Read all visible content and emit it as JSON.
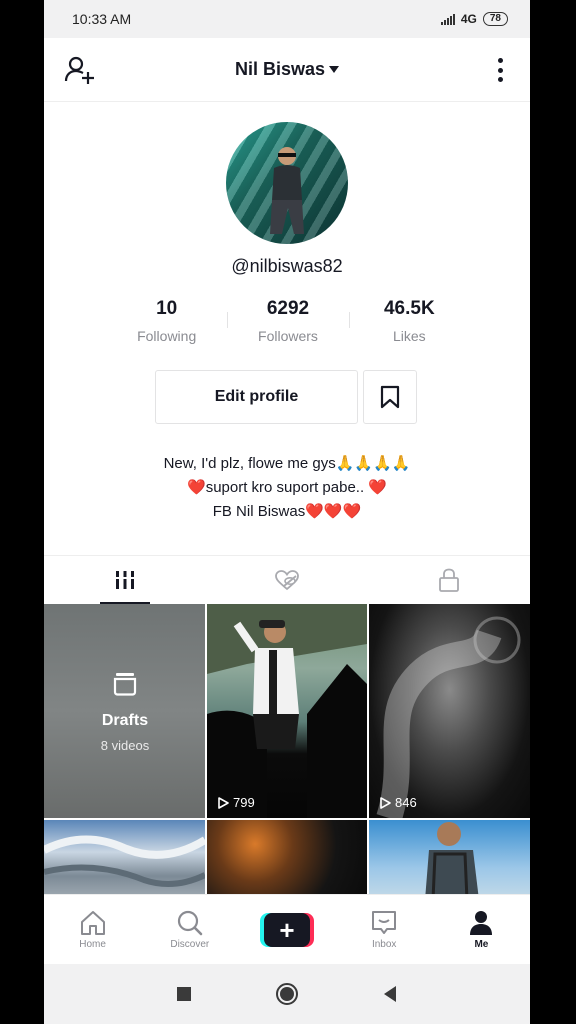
{
  "status_bar": {
    "time": "10:33 AM",
    "network": "4G",
    "battery": "78"
  },
  "header": {
    "title": "Nil Biswas"
  },
  "profile": {
    "handle": "@nilbiswas82",
    "stats": [
      {
        "value": "10",
        "label": "Following"
      },
      {
        "value": "6292",
        "label": "Followers"
      },
      {
        "value": "46.5K",
        "label": "Likes"
      }
    ],
    "edit_label": "Edit profile",
    "bio_lines": [
      "New, I'd plz, flowe me gys🙏🙏🙏🙏",
      "❤️suport kro suport pabe.. ❤️",
      "FB Nil Biswas❤️❤️❤️"
    ]
  },
  "grid": {
    "drafts_title": "Drafts",
    "drafts_count": "8 videos",
    "videos": [
      {
        "views": "799"
      },
      {
        "views": "846"
      }
    ]
  },
  "bottom_nav": {
    "items": [
      {
        "label": "Home",
        "icon": "home-icon"
      },
      {
        "label": "Discover",
        "icon": "search-icon"
      },
      {
        "label": "",
        "icon": "plus-icon"
      },
      {
        "label": "Inbox",
        "icon": "inbox-icon"
      },
      {
        "label": "Me",
        "icon": "person-icon"
      }
    ]
  }
}
